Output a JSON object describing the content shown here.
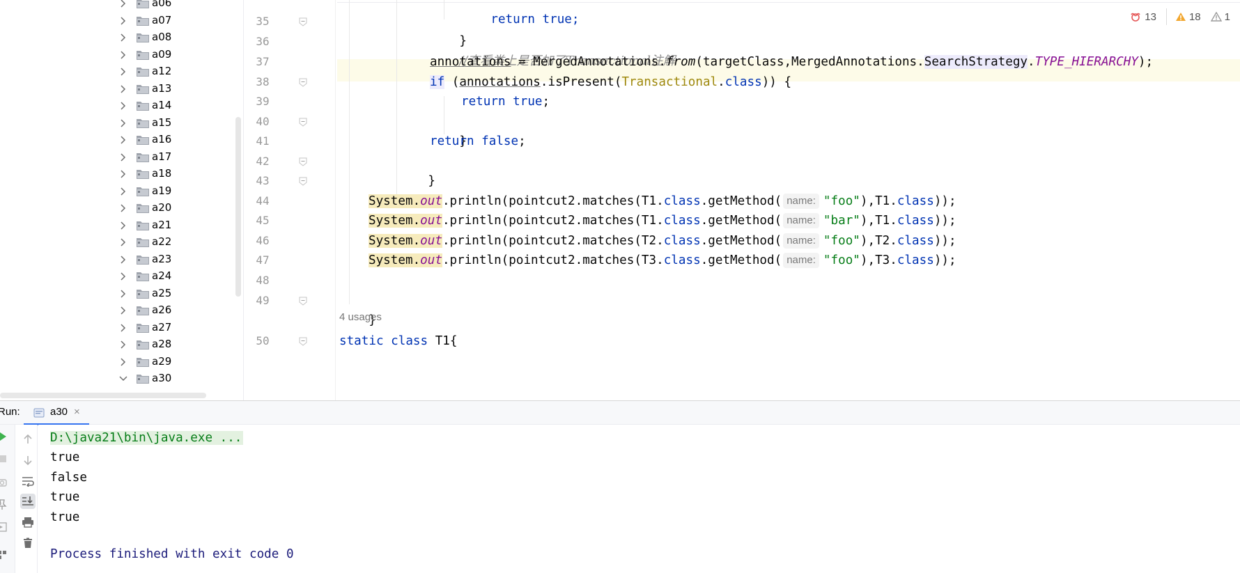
{
  "project_tree": {
    "items": [
      {
        "label": "a06",
        "expanded": false
      },
      {
        "label": "a07",
        "expanded": false
      },
      {
        "label": "a08",
        "expanded": false
      },
      {
        "label": "a09",
        "expanded": false
      },
      {
        "label": "a12",
        "expanded": false
      },
      {
        "label": "a13",
        "expanded": false
      },
      {
        "label": "a14",
        "expanded": false
      },
      {
        "label": "a15",
        "expanded": false
      },
      {
        "label": "a16",
        "expanded": false
      },
      {
        "label": "a17",
        "expanded": false
      },
      {
        "label": "a18",
        "expanded": false
      },
      {
        "label": "a19",
        "expanded": false
      },
      {
        "label": "a20",
        "expanded": false
      },
      {
        "label": "a21",
        "expanded": false
      },
      {
        "label": "a22",
        "expanded": false
      },
      {
        "label": "a23",
        "expanded": false
      },
      {
        "label": "a24",
        "expanded": false
      },
      {
        "label": "a25",
        "expanded": false
      },
      {
        "label": "a26",
        "expanded": false
      },
      {
        "label": "a27",
        "expanded": false
      },
      {
        "label": "a28",
        "expanded": false
      },
      {
        "label": "a29",
        "expanded": false
      },
      {
        "label": "a30",
        "expanded": true
      }
    ]
  },
  "editor": {
    "inspections": {
      "errors": "13",
      "warnings": "18",
      "weak_warnings": "1"
    },
    "line_numbers": [
      "35",
      "36",
      "37",
      "38",
      "39",
      "40",
      "41",
      "42",
      "43",
      "44",
      "45",
      "46",
      "47",
      "48",
      "49",
      "50"
    ],
    "code": {
      "l34_partial": "return true;",
      "l35_brace": "}",
      "l36_comment": "//查看类上是否加了Transactional注解",
      "l37_var": "annotations",
      "l37_eq": " = MergedAnnotations.",
      "l37_from": "from",
      "l37_args": "(targetClass,MergedAnnotations.",
      "l37_strategy": "SearchStrategy",
      "l37_dot": ".",
      "l37_const": "TYPE_HIERARCHY",
      "l37_end": ");",
      "l38_if": "if",
      "l38_open": " (",
      "l38_var": "annotations",
      "l38_mid": ".isPresent(",
      "l38_cls": "Transactional",
      "l38_dot": ".",
      "l38_class_kw": "class",
      "l38_end": ")) {",
      "l39_return": "return",
      "l39_true": "true",
      "l39_semi": ";",
      "l40_brace": "}",
      "l41_return": "return",
      "l41_false": "false",
      "l41_semi": ";",
      "l42_brace": "}",
      "l43_close": "};",
      "println_lines": [
        {
          "system": "System",
          "dot": ".",
          "out": "out",
          "call": ".println(pointcut2.matches(T1.",
          "class1": "class",
          "mid": ".getMethod(",
          "hint": "name:",
          "arg": "\"foo\"",
          "tail1": "),T1.",
          "class2": "class",
          "tail2": "));"
        },
        {
          "system": "System",
          "dot": ".",
          "out": "out",
          "call": ".println(pointcut2.matches(T1.",
          "class1": "class",
          "mid": ".getMethod(",
          "hint": "name:",
          "arg": "\"bar\"",
          "tail1": "),T1.",
          "class2": "class",
          "tail2": "));"
        },
        {
          "system": "System",
          "dot": ".",
          "out": "out",
          "call": ".println(pointcut2.matches(T2.",
          "class1": "class",
          "mid": ".getMethod(",
          "hint": "name:",
          "arg": "\"foo\"",
          "tail1": "),T2.",
          "class2": "class",
          "tail2": "));"
        },
        {
          "system": "System",
          "dot": ".",
          "out": "out",
          "call": ".println(pointcut2.matches(T3.",
          "class1": "class",
          "mid": ".getMethod(",
          "hint": "name:",
          "arg": "\"foo\"",
          "tail1": "),T3.",
          "class2": "class",
          "tail2": "));"
        }
      ],
      "l49_brace": "}",
      "usages": "4 usages",
      "l50_static": "static",
      "l50_class": "class",
      "l50_name": " T1{"
    }
  },
  "run_window": {
    "label": "Run:",
    "tab_label": "a30",
    "tab_close": "×",
    "console": [
      "D:\\java21\\bin\\java.exe ...",
      "true",
      "false",
      "true",
      "true",
      "Process finished with exit code 0"
    ]
  },
  "colors": {
    "keyword": "#0033b3",
    "string": "#067d17",
    "static_field": "#871094",
    "comment": "#8c8c8c",
    "accent": "#3574f0"
  }
}
